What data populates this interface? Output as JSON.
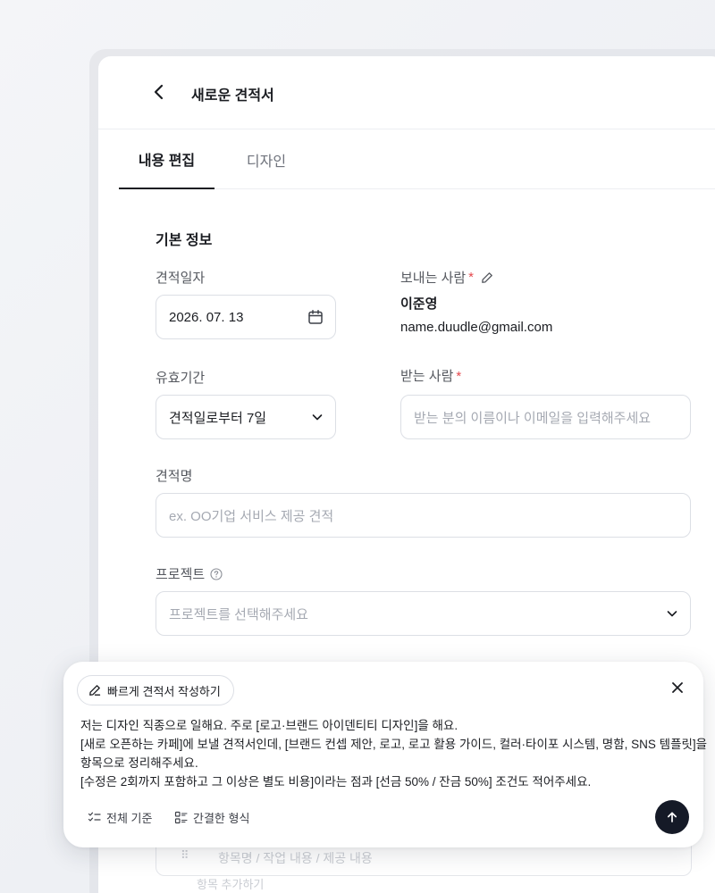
{
  "header": {
    "title": "새로운 견적서"
  },
  "tabs": [
    {
      "label": "내용 편집",
      "active": true
    },
    {
      "label": "디자인",
      "active": false
    }
  ],
  "basic_info": {
    "section_title": "기본 정보",
    "quote_date": {
      "label": "견적일자",
      "value": "2026. 07. 13"
    },
    "sender": {
      "label": "보내는 사람",
      "required": "*",
      "name": "이준영",
      "email": "name.duudle@gmail.com"
    },
    "validity": {
      "label": "유효기간",
      "value": "견적일로부터 7일"
    },
    "recipient": {
      "label": "받는 사람",
      "required": "*",
      "placeholder": "받는 분의 이름이나 이메일을 입력해주세요"
    },
    "quote_name": {
      "label": "견적명",
      "placeholder": "ex. OO기업 서비스 제공 견적"
    },
    "project": {
      "label": "프로젝트",
      "placeholder": "프로젝트를 선택해주세요"
    }
  },
  "items_behind": {
    "row_placeholder": "항목명 / 작업 내용 / 제공 내용",
    "helper": "항목 추가하기"
  },
  "assistant": {
    "chip_label": "빠르게 견적서 작성하기",
    "prompt_lines": [
      "저는 디자인 직종으로 일해요. 주로 [로고·브랜드 아이덴티티 디자인]을 해요.",
      "[새로 오픈하는 카페]에 보낼 견적서인데, [브랜드 컨셉 제안, 로고, 로고 활용 가이드, 컬러·타이포 시스템, 명함, SNS 템플릿]을",
      "항목으로 정리해주세요.",
      "[수정은 2회까지 포함하고 그 이상은 별도 비용]이라는 점과 [선금 50% / 잔금 50%] 조건도 적어주세요."
    ],
    "option_all": "전체 기준",
    "option_concise": "간결한 형식"
  },
  "colors": {
    "accent_dark": "#151a27",
    "required": "#e5484d"
  }
}
